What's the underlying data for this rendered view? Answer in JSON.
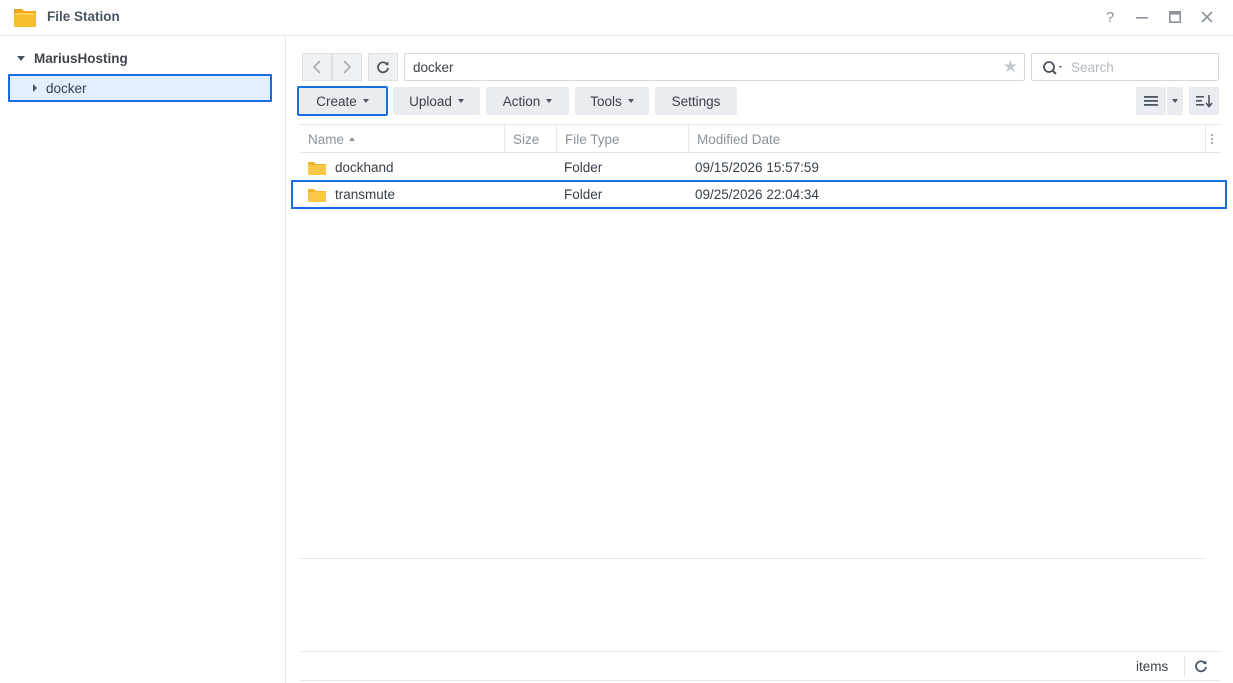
{
  "window": {
    "title": "File Station",
    "controls": {
      "help": "?",
      "minimize": "–",
      "maximize": "□",
      "close": "×"
    }
  },
  "sidebar": {
    "root": "MariusHosting",
    "items": [
      {
        "label": "docker",
        "selected": true
      }
    ]
  },
  "nav": {
    "path": "docker",
    "search_placeholder": "Search"
  },
  "toolbar": {
    "create": "Create",
    "upload": "Upload",
    "action": "Action",
    "tools": "Tools",
    "settings": "Settings"
  },
  "table": {
    "columns": {
      "name": "Name",
      "size": "Size",
      "type": "File Type",
      "modified": "Modified Date"
    },
    "rows": [
      {
        "name": "dockhand",
        "size": "",
        "type": "Folder",
        "modified": "09/15/2026 15:57:59"
      },
      {
        "name": "transmute",
        "size": "",
        "type": "Folder",
        "modified": "09/25/2026 22:04:34",
        "highlighted": true
      }
    ]
  },
  "status": {
    "items_label": "items"
  },
  "colors": {
    "accent": "#1a6fe0",
    "selected_bg": "#e3efff",
    "folder": "#f7c443"
  }
}
